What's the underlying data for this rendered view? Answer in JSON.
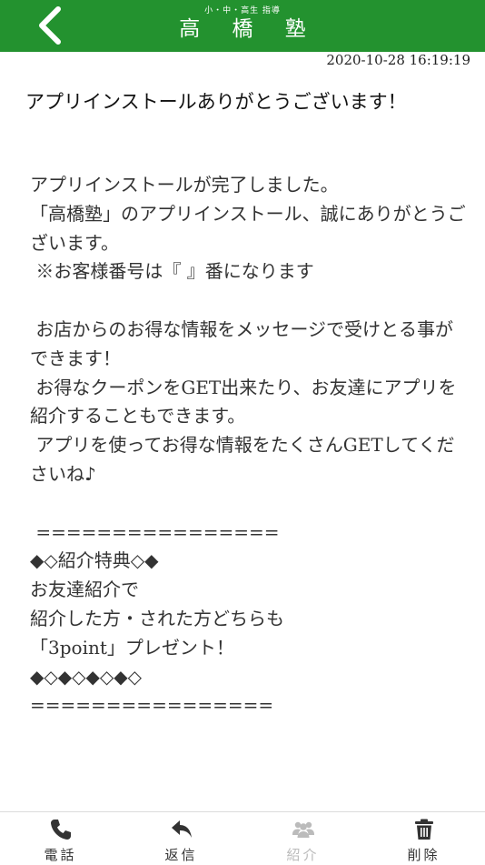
{
  "header": {
    "subtitle": "小・中・高生 指導",
    "title": "高 橋 塾"
  },
  "message": {
    "timestamp": "2020-10-28 16:19:19",
    "title": "アプリインストールありがとうございます！",
    "body": "アプリインストールが完了しました。\n「高橋塾」のアプリインストール、誠にありがとうございます。\n ※お客様番号は『 』番になります\n\n お店からのお得な情報をメッセージで受けとる事ができます！\n お得なクーポンをGET出来たり、お友達にアプリを紹介することもできます。\n アプリを使ってお得な情報をたくさんGETしてくださいね♪\n\n ================\n◆◇紹介特典◇◆\nお友達紹介で\n紹介した方・された方どちらも\n「3point」プレゼント！\n◆◇◆◇◆◇◆◇\n================"
  },
  "tabbar": {
    "tabs": [
      {
        "label": "電話",
        "icon": "phone-icon"
      },
      {
        "label": "返信",
        "icon": "reply-icon"
      },
      {
        "label": "紹介",
        "icon": "group-icon"
      },
      {
        "label": "削除",
        "icon": "trash-icon"
      }
    ]
  },
  "colors": {
    "header": "#23922f",
    "icon": "#333333",
    "disabled": "#bbbbbb"
  }
}
